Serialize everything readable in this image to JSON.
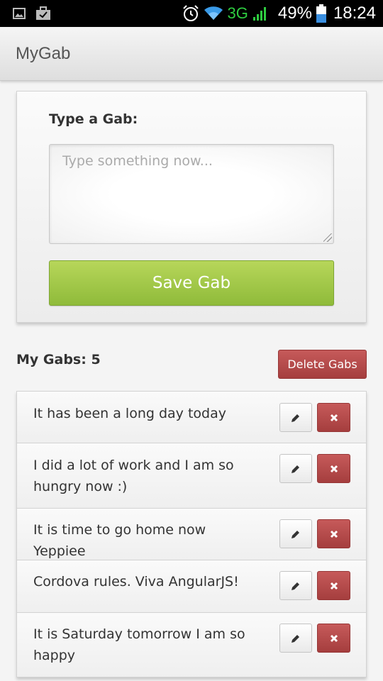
{
  "status_bar": {
    "icons": [
      "image-icon",
      "briefcase-check-icon",
      "alarm-icon",
      "wifi-icon",
      "signal-icon",
      "battery-icon"
    ],
    "network": "3G",
    "battery": "49%",
    "time": "18:24"
  },
  "app": {
    "title": "MyGab"
  },
  "form": {
    "label": "Type a Gab:",
    "input_value": "",
    "input_placeholder": "Type something now...",
    "save_label": "Save Gab"
  },
  "list": {
    "count_label": "My Gabs: 5",
    "delete_all_label": "Delete Gabs",
    "items": [
      {
        "text": "It has been a long day today"
      },
      {
        "text": "I did a lot of work and I am so hungry now :)"
      },
      {
        "text": "It is time to go home now Yeppiee"
      },
      {
        "text": "Cordova rules. Viva AngularJS!"
      },
      {
        "text": "It is Saturday tomorrow I am so happy"
      }
    ]
  },
  "colors": {
    "save_green": "#9fc64a",
    "delete_red": "#b44a4a",
    "network_green": "#2ecc40",
    "battery_blue": "#3a8fe0"
  }
}
